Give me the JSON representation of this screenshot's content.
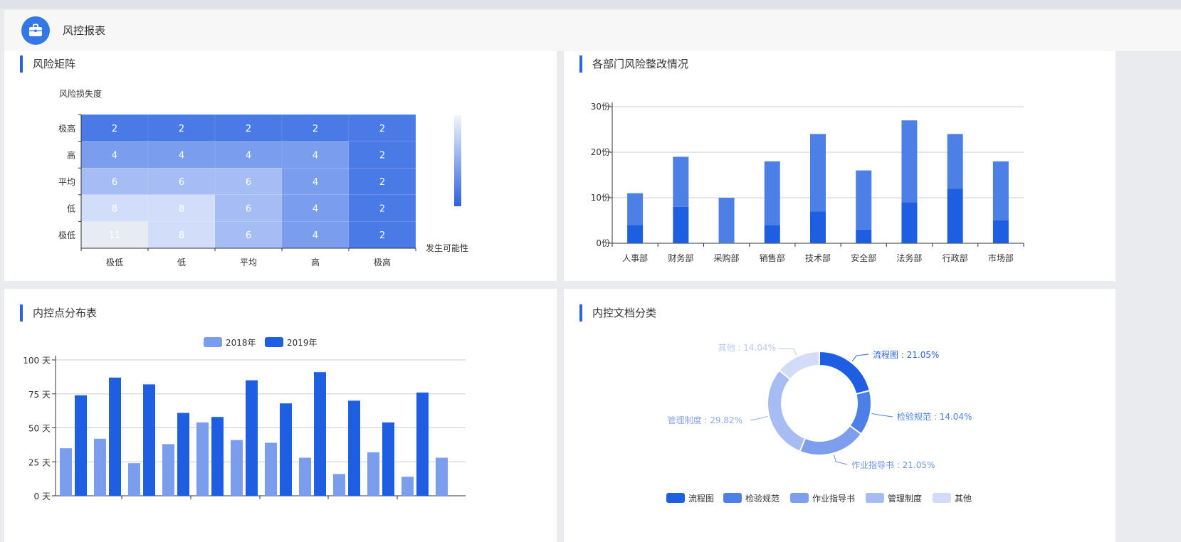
{
  "header": {
    "title": "风控报表",
    "logo_icon": "briefcase-icon"
  },
  "risk_matrix": {
    "title": "风险矩阵",
    "y_axis_name": "风险损失度",
    "x_axis_name": "发生可能性",
    "y_labels": [
      "极高",
      "高",
      "平均",
      "低",
      "极低"
    ],
    "x_labels": [
      "极低",
      "低",
      "平均",
      "高",
      "极高"
    ],
    "colors": {
      "2": "#4a7ae6",
      "4": "#7b9ded",
      "6": "#a6bdf3",
      "8": "#d2def9",
      "11": "#e7ebf4"
    },
    "visual_map_colors": [
      "#f3f5fc",
      "#2b62df"
    ]
  },
  "dept_rectification": {
    "title": "各部门风险整改情况",
    "y_suffix": "份",
    "colors": {
      "done": "#1e5fe2",
      "total": "#4d80e6"
    }
  },
  "internal_control": {
    "title": "内控点分布表",
    "y_suffix": " 天",
    "legend": [
      "2018年",
      "2019年"
    ],
    "colors": {
      "s2018": "#7b9ded",
      "s2019": "#1e5fe2"
    }
  },
  "doc_classification": {
    "title": "内控文档分类",
    "colors": [
      "#1e5fe2",
      "#4d80e6",
      "#7d9ded",
      "#a7bcf2",
      "#d2dcf8"
    ],
    "label_colors": [
      "#2e63e0",
      "#4d80e6",
      "#6e93eb",
      "#8ea9ee",
      "#b9c8f2"
    ]
  },
  "chart_data": [
    {
      "type": "heatmap",
      "title": "风险矩阵",
      "xlabel": "发生可能性",
      "ylabel": "风险损失度",
      "x_categories": [
        "极低",
        "低",
        "平均",
        "高",
        "极高"
      ],
      "y_categories": [
        "极高",
        "高",
        "平均",
        "低",
        "极低"
      ],
      "values": [
        [
          2,
          2,
          2,
          2,
          2
        ],
        [
          4,
          4,
          4,
          4,
          2
        ],
        [
          6,
          6,
          6,
          4,
          2
        ],
        [
          8,
          8,
          6,
          4,
          2
        ],
        [
          11,
          8,
          6,
          4,
          2
        ]
      ]
    },
    {
      "type": "bar",
      "title": "各部门风险整改情况",
      "categories": [
        "人事部",
        "财务部",
        "采购部",
        "销售部",
        "技术部",
        "安全部",
        "法务部",
        "行政部",
        "市场部"
      ],
      "stacked": true,
      "series": [
        {
          "values": [
            4,
            8,
            0,
            4,
            7,
            3,
            9,
            12,
            5
          ]
        },
        {
          "values": [
            7,
            11,
            10,
            14,
            17,
            13,
            18,
            12,
            13
          ]
        }
      ],
      "totals": [
        11,
        19,
        10,
        18,
        24,
        16,
        27,
        24,
        18
      ],
      "yticks": [
        "0份",
        "10份",
        "20份",
        "30份"
      ],
      "ylim": [
        0,
        30
      ],
      "grid": true
    },
    {
      "type": "bar",
      "title": "内控点分布表",
      "series": [
        {
          "name": "2018年",
          "values": [
            35,
            42,
            24,
            38,
            54,
            41,
            39,
            28,
            16,
            32,
            14,
            28
          ]
        },
        {
          "name": "2019年",
          "values": [
            74,
            87,
            82,
            61,
            58,
            85,
            68,
            91,
            70,
            54,
            76
          ]
        }
      ],
      "yticks": [
        "0 天",
        "25 天",
        "50 天",
        "75 天",
        "100 天"
      ],
      "ylim": [
        0,
        100
      ],
      "legend_position": "top-center",
      "grid": true
    },
    {
      "type": "pie",
      "title": "内控文档分类",
      "donut": true,
      "labels": [
        "流程图",
        "检验规范",
        "作业指导书",
        "管理制度",
        "其他"
      ],
      "values": [
        21.05,
        14.04,
        21.05,
        29.82,
        14.04
      ],
      "label_texts": [
        "流程图 : 21.05%",
        "检验规范 : 14.04%",
        "作业指导书 : 21.05%",
        "管理制度 : 29.82%",
        "其他 : 14.04%"
      ],
      "legend_position": "bottom-center"
    }
  ]
}
